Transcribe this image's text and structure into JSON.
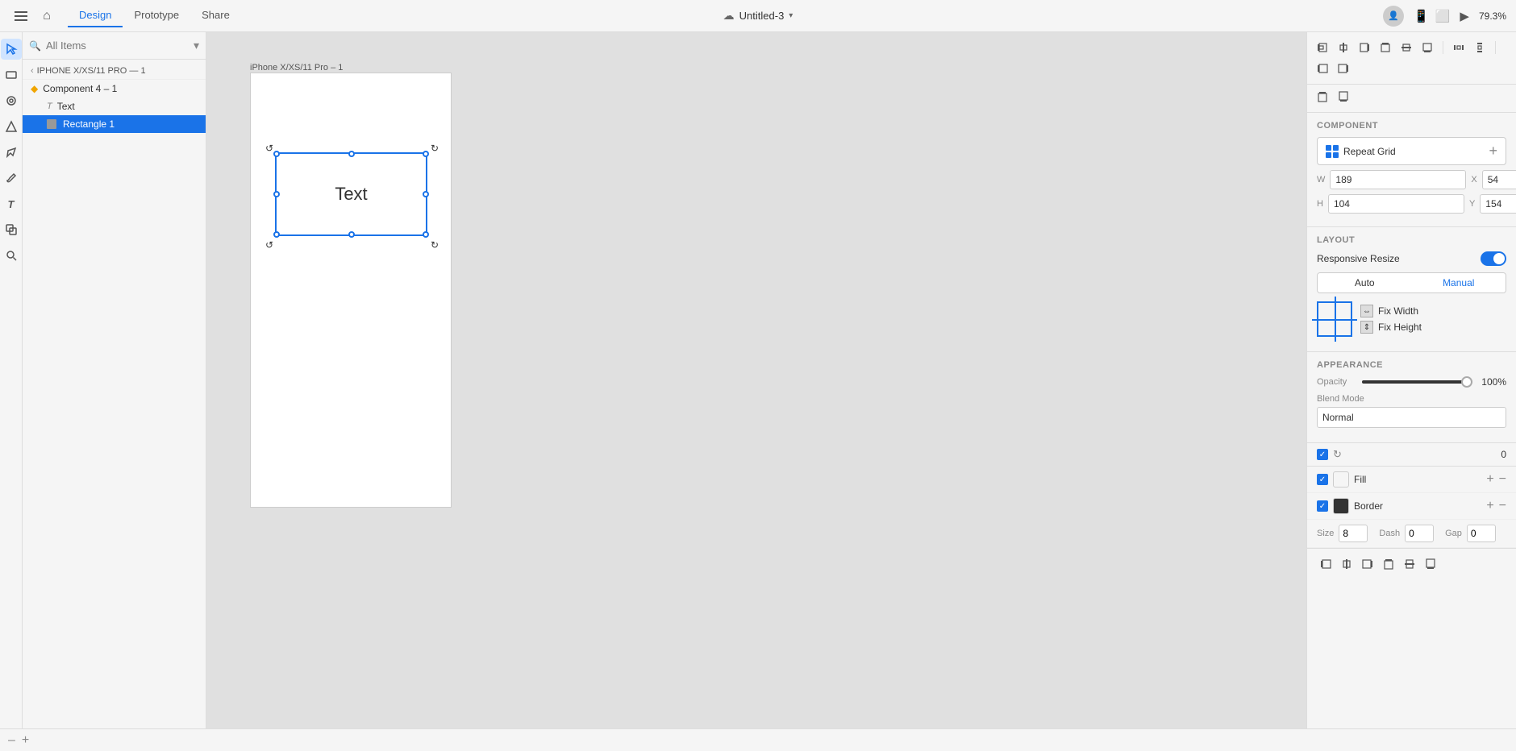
{
  "topbar": {
    "tabs": [
      {
        "label": "Design",
        "active": true
      },
      {
        "label": "Prototype",
        "active": false
      },
      {
        "label": "Share",
        "active": false
      }
    ],
    "project_title": "Untitled-3",
    "zoom_level": "79.3%",
    "play_icon": "▶"
  },
  "layers": {
    "search_placeholder": "All Items",
    "breadcrumb": "IPHONE X/XS/11 PRO — 1",
    "items": [
      {
        "label": "Component 4 – 1",
        "type": "component",
        "indent": 0
      },
      {
        "label": "Text",
        "type": "text",
        "indent": 1
      },
      {
        "label": "Rectangle 1",
        "type": "rect",
        "indent": 1,
        "selected": true
      }
    ]
  },
  "artboard": {
    "label": "iPhone X/XS/11 Pro – 1",
    "canvas_text": "Text"
  },
  "right_panel": {
    "component_label": "COMPONENT",
    "repeat_grid_label": "Repeat Grid",
    "w_label": "W",
    "h_label": "H",
    "x_label": "X",
    "y_label": "Y",
    "w_value": "189",
    "h_value": "104",
    "x_value": "54",
    "y_value": "154",
    "rotation_value": "0°",
    "layout_label": "LAYOUT",
    "responsive_resize_label": "Responsive Resize",
    "auto_label": "Auto",
    "manual_label": "Manual",
    "fix_width_label": "Fix Width",
    "fix_height_label": "Fix Height",
    "appearance_label": "APPEARANCE",
    "opacity_label": "Opacity",
    "opacity_value": "100%",
    "blend_mode_label": "Blend Mode",
    "blend_mode_value": "Normal",
    "shadow_value": "0",
    "fill_label": "Fill",
    "border_label": "Border",
    "size_label": "Size",
    "size_value": "8",
    "dash_label": "Dash",
    "dash_value": "0",
    "gap_label": "Gap",
    "gap_value": "0"
  },
  "bottom": {
    "plus_label": "+",
    "minus_label": "–"
  }
}
